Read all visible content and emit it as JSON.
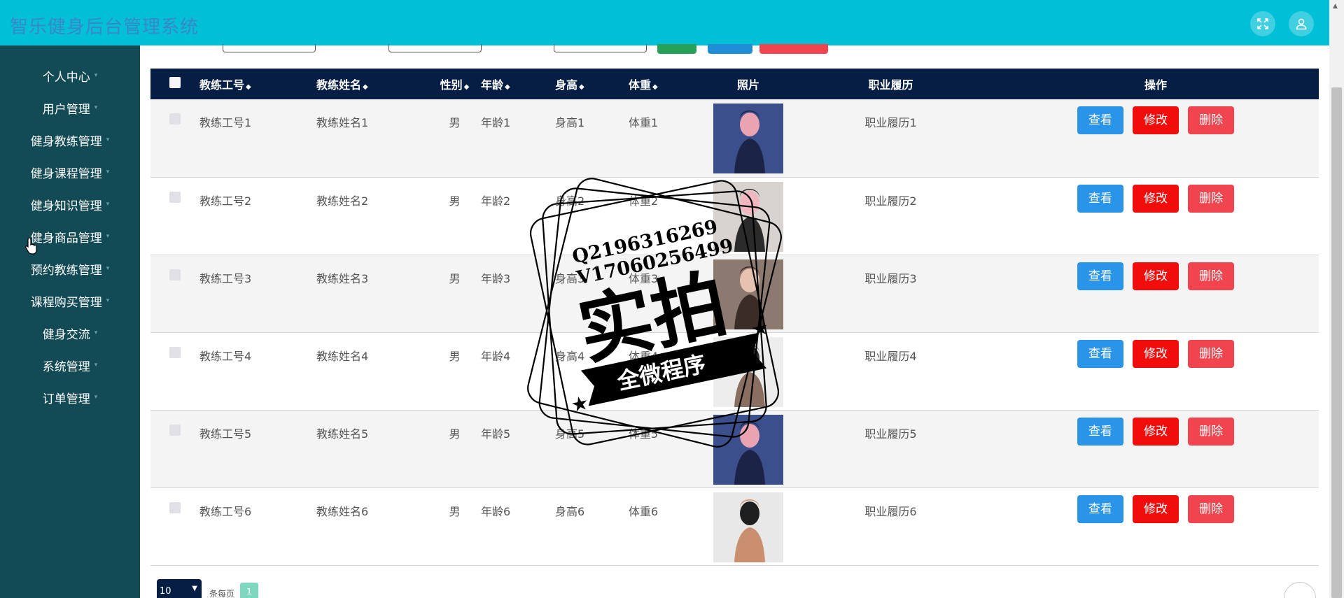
{
  "header": {
    "title": "智乐健身后台管理系统",
    "fullscreen_icon": "fullscreen-icon",
    "user_icon": "user-icon"
  },
  "sidebar": {
    "items": [
      {
        "label": "个人中心"
      },
      {
        "label": "用户管理"
      },
      {
        "label": "健身教练管理"
      },
      {
        "label": "健身课程管理"
      },
      {
        "label": "健身知识管理"
      },
      {
        "label": "健身商品管理"
      },
      {
        "label": "预约教练管理"
      },
      {
        "label": "课程购买管理"
      },
      {
        "label": "健身交流"
      },
      {
        "label": "系统管理"
      },
      {
        "label": "订单管理"
      }
    ]
  },
  "table": {
    "columns": {
      "coach_id": "教练工号",
      "coach_name": "教练姓名",
      "gender": "性别",
      "age": "年龄",
      "height": "身高",
      "weight": "体重",
      "photo": "照片",
      "resume": "职业履历",
      "ops": "操作"
    },
    "rows": [
      {
        "coach_id": "教练工号1",
        "coach_name": "教练姓名1",
        "gender": "男",
        "age": "年龄1",
        "height": "身高1",
        "weight": "体重1",
        "resume": "职业履历1"
      },
      {
        "coach_id": "教练工号2",
        "coach_name": "教练姓名2",
        "gender": "男",
        "age": "年龄2",
        "height": "身高2",
        "weight": "体重2",
        "resume": "职业履历2"
      },
      {
        "coach_id": "教练工号3",
        "coach_name": "教练姓名3",
        "gender": "男",
        "age": "年龄3",
        "height": "身高3",
        "weight": "体重3",
        "resume": "职业履历3"
      },
      {
        "coach_id": "教练工号4",
        "coach_name": "教练姓名4",
        "gender": "男",
        "age": "年龄4",
        "height": "身高4",
        "weight": "体重4",
        "resume": "职业履历4"
      },
      {
        "coach_id": "教练工号5",
        "coach_name": "教练姓名5",
        "gender": "男",
        "age": "年龄5",
        "height": "身高5",
        "weight": "体重5",
        "resume": "职业履历5"
      },
      {
        "coach_id": "教练工号6",
        "coach_name": "教练姓名6",
        "gender": "男",
        "age": "年龄6",
        "height": "身高6",
        "weight": "体重6",
        "resume": "职业履历6"
      }
    ],
    "buttons": {
      "view": "查看",
      "edit": "修改",
      "delete": "删除"
    }
  },
  "pagination": {
    "page_size": "10",
    "per_page_label": "条每页",
    "current_page": "1"
  },
  "watermark": {
    "qq": "Q2196316269",
    "wx": "V17060256499",
    "main_text": "实拍",
    "ribbon_text": "全微程序"
  },
  "colors": {
    "header_bg": "#00c0d8",
    "sidebar_bg": "#124a55",
    "table_header_bg": "#061e44",
    "view_btn": "#2994e8",
    "edit_btn": "#f20d0d",
    "delete_btn": "#f0454f"
  }
}
